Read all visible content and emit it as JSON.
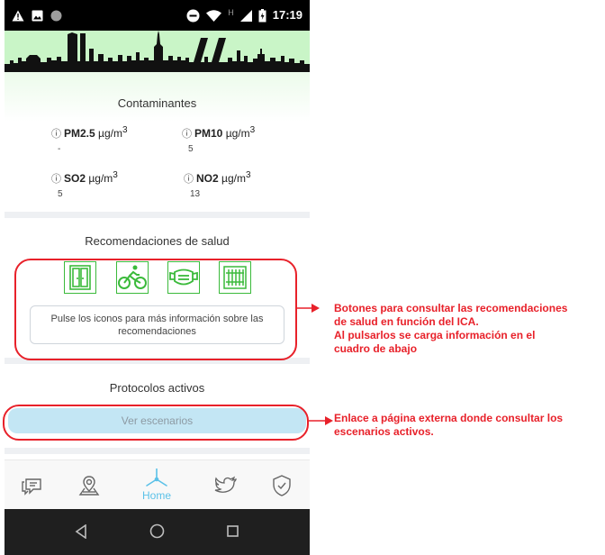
{
  "status_bar": {
    "time": "17:19",
    "network_letter": "H",
    "icons": [
      "warning-icon",
      "image-icon",
      "circle-icon",
      "do-not-disturb-icon",
      "wifi-icon",
      "signal-icon",
      "battery-icon"
    ]
  },
  "header": {
    "image": "madrid-skyline",
    "colors": {
      "background": "#c9f5c7",
      "silhouette": "#111111"
    }
  },
  "pollutants": {
    "title": "Contaminantes",
    "items": [
      {
        "info_glyph": "ⓘ",
        "name": "PM2.5",
        "unit": "µg/m",
        "exponent": "3",
        "value": "-"
      },
      {
        "info_glyph": "ⓘ",
        "name": "PM10",
        "unit": "µg/m",
        "exponent": "3",
        "value": "5"
      },
      {
        "info_glyph": "ⓘ",
        "name": "SO2",
        "unit": "µg/m",
        "exponent": "3",
        "value": "5"
      },
      {
        "info_glyph": "ⓘ",
        "name": "NO2",
        "unit": "µg/m",
        "exponent": "3",
        "value": "13"
      }
    ]
  },
  "health": {
    "title": "Recomendaciones de salud",
    "icons": [
      "window-icon",
      "cycling-icon",
      "face-mask-icon",
      "radiator-icon"
    ],
    "info_text": "Pulse los iconos para más información sobre las recomendaciones"
  },
  "protocols": {
    "title": "Protocolos activos",
    "button_label": "Ver escenarios"
  },
  "bottom_nav": {
    "items": [
      {
        "icon": "chat-icon",
        "label": ""
      },
      {
        "icon": "map-pin-icon",
        "label": ""
      },
      {
        "icon": "windmill-icon",
        "label": "Home"
      },
      {
        "icon": "twitter-icon",
        "label": ""
      },
      {
        "icon": "shield-check-icon",
        "label": ""
      }
    ],
    "active_color": "#5bc1e8"
  },
  "android_nav": {
    "icons": [
      "back-icon",
      "home-circle-icon",
      "recents-icon"
    ]
  },
  "annotations": {
    "color": "#e8212a",
    "health_buttons": [
      "Botones para consultar las recomendaciones",
      "de salud en función del ICA.",
      "Al pulsarlos se carga información en el",
      "cuadro de abajo"
    ],
    "scenarios_link": [
      "Enlace a página externa donde consultar los",
      "escenarios activos."
    ]
  }
}
